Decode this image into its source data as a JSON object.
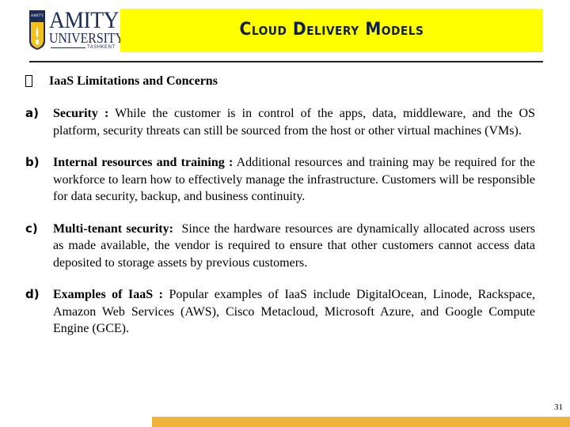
{
  "logo": {
    "shield_text": "AMITY",
    "line1": "AMITY",
    "line2": "UNIVERSITY",
    "line3": "TASHKENT"
  },
  "header": {
    "title": "Cloud Delivery Models"
  },
  "section": {
    "heading": "IaaS Limitations and Concerns",
    "items": [
      {
        "marker": "a)",
        "lead": "Security :",
        "text": " While the customer is in control of the apps, data, middleware, and the OS platform, security threats can still be sourced from the host or other virtual machines (VMs)."
      },
      {
        "marker": "b)",
        "lead": "Internal resources and training :",
        "text": " Additional resources and training may be required for the workforce to learn how to effectively manage the infrastructure. Customers will be responsible for data security, backup, and business continuity."
      },
      {
        "marker": "c)",
        "lead": "Multi-tenant security:",
        "text": "  Since the hardware resources are dynamically allocated across users as made available, the vendor is required to ensure that other customers cannot access data deposited to storage assets by previous customers."
      },
      {
        "marker": "d)",
        "lead": "Examples of IaaS :",
        "text": " Popular examples of IaaS include DigitalOcean, Linode, Rackspace, Amazon Web Services (AWS), Cisco Metacloud, Microsoft Azure, and Google Compute Engine (GCE)."
      }
    ]
  },
  "footer": {
    "page_number": "31"
  },
  "colors": {
    "title_bar": "#ffff00",
    "title_text": "#0f1f45",
    "footer_bar": "#efb33a",
    "logo_navy": "#1c2b57",
    "logo_gold": "#f2c11c"
  }
}
